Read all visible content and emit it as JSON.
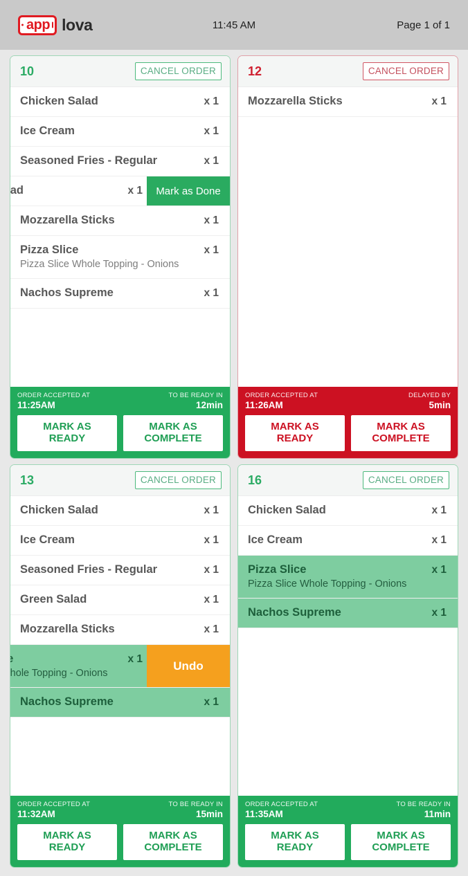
{
  "topbar": {
    "logo_mark": "app",
    "logo_word": "lova",
    "clock": "11:45 AM",
    "pager": "Page 1 of 1"
  },
  "labels": {
    "cancel_order": "CANCEL ORDER",
    "accepted_at": "ORDER ACCEPTED AT",
    "ready_in": "TO BE READY IN",
    "delayed_by": "DELAYED BY",
    "mark_as_ready_l1": "MARK AS",
    "mark_as_ready_l2": "READY",
    "mark_as_complete_l1": "MARK AS",
    "mark_as_complete_l2": "COMPLETE",
    "mark_as_done": "Mark as Done",
    "undo": "Undo"
  },
  "colors": {
    "green": "#22ab5c",
    "green_border": "#9fd6b6",
    "green_done_row": "#7ecda0",
    "red": "#cc1122",
    "red_border": "#e0a0a8",
    "orange": "#f5a01e",
    "page_bg": "#e8e8e8",
    "topbar_bg": "#c9c9c9",
    "logo_red": "#e01b22"
  },
  "orders": [
    {
      "number": "10",
      "status": "ontime",
      "accepted_at": "11:25AM",
      "timer_label": "TO BE READY IN",
      "timer_value": "12min",
      "items": [
        {
          "name": "Chicken Salad",
          "qty": "x 1",
          "mod": "",
          "done": false,
          "swiped": false
        },
        {
          "name": "Ice Cream",
          "qty": "x 1",
          "mod": "",
          "done": false,
          "swiped": false
        },
        {
          "name": "Seasoned Fries - Regular",
          "qty": "x 1",
          "mod": "",
          "done": false,
          "swiped": false
        },
        {
          "name": "alad",
          "qty": "x 1",
          "mod": "",
          "done": false,
          "swiped": true,
          "action": "Mark as Done"
        },
        {
          "name": "Mozzarella Sticks",
          "qty": "x 1",
          "mod": "",
          "done": false,
          "swiped": false
        },
        {
          "name": "Pizza Slice",
          "qty": "x 1",
          "mod": "Pizza Slice Whole Topping - Onions",
          "done": false,
          "swiped": false
        },
        {
          "name": "Nachos Supreme",
          "qty": "x 1",
          "mod": "",
          "done": false,
          "swiped": false
        }
      ]
    },
    {
      "number": "12",
      "status": "delayed",
      "accepted_at": "11:26AM",
      "timer_label": "DELAYED BY",
      "timer_value": "5min",
      "items": [
        {
          "name": "Mozzarella Sticks",
          "qty": "x 1",
          "mod": "",
          "done": false,
          "swiped": false
        }
      ]
    },
    {
      "number": "13",
      "status": "ontime",
      "accepted_at": "11:32AM",
      "timer_label": "TO BE READY IN",
      "timer_value": "15min",
      "items": [
        {
          "name": "Chicken Salad",
          "qty": "x 1",
          "mod": "",
          "done": false,
          "swiped": false
        },
        {
          "name": "Ice Cream",
          "qty": "x 1",
          "mod": "",
          "done": false,
          "swiped": false
        },
        {
          "name": "Seasoned Fries - Regular",
          "qty": "x 1",
          "mod": "",
          "done": false,
          "swiped": false
        },
        {
          "name": "Green Salad",
          "qty": "x 1",
          "mod": "",
          "done": false,
          "swiped": false
        },
        {
          "name": "Mozzarella Sticks",
          "qty": "x 1",
          "mod": "",
          "done": false,
          "swiped": false
        },
        {
          "name": "ce",
          "qty": "x 1",
          "mod": "Whole Topping - Onions",
          "done": true,
          "swiped": true,
          "action": "Undo"
        },
        {
          "name": "Nachos Supreme",
          "qty": "x 1",
          "mod": "",
          "done": true,
          "swiped": false
        }
      ]
    },
    {
      "number": "16",
      "status": "ontime",
      "accepted_at": "11:35AM",
      "timer_label": "TO BE READY IN",
      "timer_value": "11min",
      "items": [
        {
          "name": "Chicken Salad",
          "qty": "x 1",
          "mod": "",
          "done": false,
          "swiped": false
        },
        {
          "name": "Ice Cream",
          "qty": "x 1",
          "mod": "",
          "done": false,
          "swiped": false
        },
        {
          "name": "Pizza Slice",
          "qty": "x 1",
          "mod": "Pizza Slice Whole Topping - Onions",
          "done": true,
          "swiped": false
        },
        {
          "name": "Nachos Supreme",
          "qty": "x 1",
          "mod": "",
          "done": true,
          "swiped": false
        }
      ]
    }
  ]
}
